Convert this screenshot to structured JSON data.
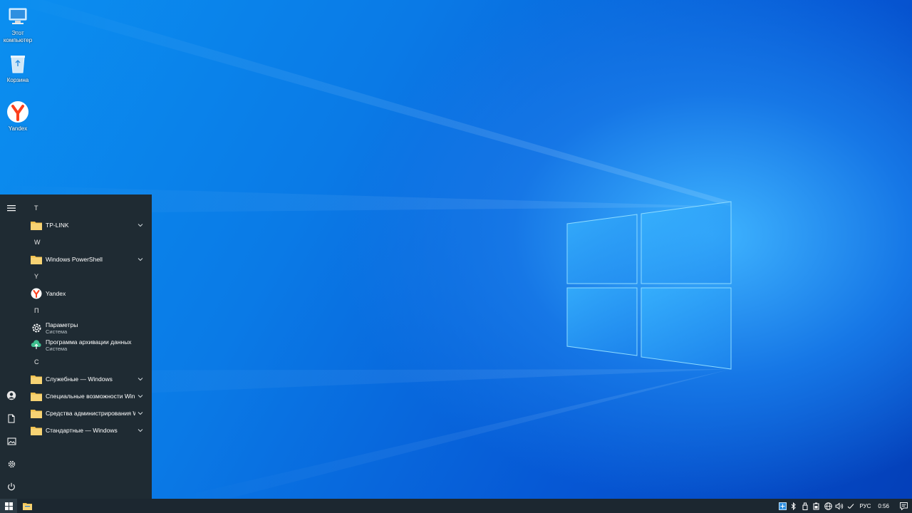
{
  "desktop": {
    "icons": [
      {
        "label": "Этот компьютер",
        "icon": "computer-icon"
      },
      {
        "label": "Корзина",
        "icon": "recycle-bin-icon"
      },
      {
        "label": "Yandex",
        "icon": "yandex-browser-icon"
      }
    ]
  },
  "start_menu": {
    "rail": [
      {
        "icon": "hamburger-menu-icon"
      },
      {
        "icon": "user-account-icon"
      },
      {
        "icon": "documents-icon"
      },
      {
        "icon": "pictures-icon"
      },
      {
        "icon": "settings-gear-icon"
      },
      {
        "icon": "power-icon"
      }
    ],
    "letters": {
      "t": "T",
      "w": "W",
      "y": "Y",
      "p": "П",
      "s": "С"
    },
    "apps": {
      "tplink": "TP-LINK",
      "powershell": "Windows PowerShell",
      "yandex": "Yandex",
      "settings": {
        "name": "Параметры",
        "sub": "Система"
      },
      "backup": {
        "name": "Программа архивации данных",
        "sub": "Система"
      },
      "system_tools": "Служебные — Windows",
      "accessibility": "Специальные возможности Win...",
      "admin_tools": "Средства администрирования W...",
      "accessories": "Стандартные — Windows"
    }
  },
  "taskbar": {
    "language": "РУС",
    "time": "0:56"
  },
  "colors": {
    "menu_bg": "#1f2b33",
    "taskbar_bg": "#1c2730",
    "folder": "#f2c14e",
    "accent": "#0a7ae6"
  }
}
